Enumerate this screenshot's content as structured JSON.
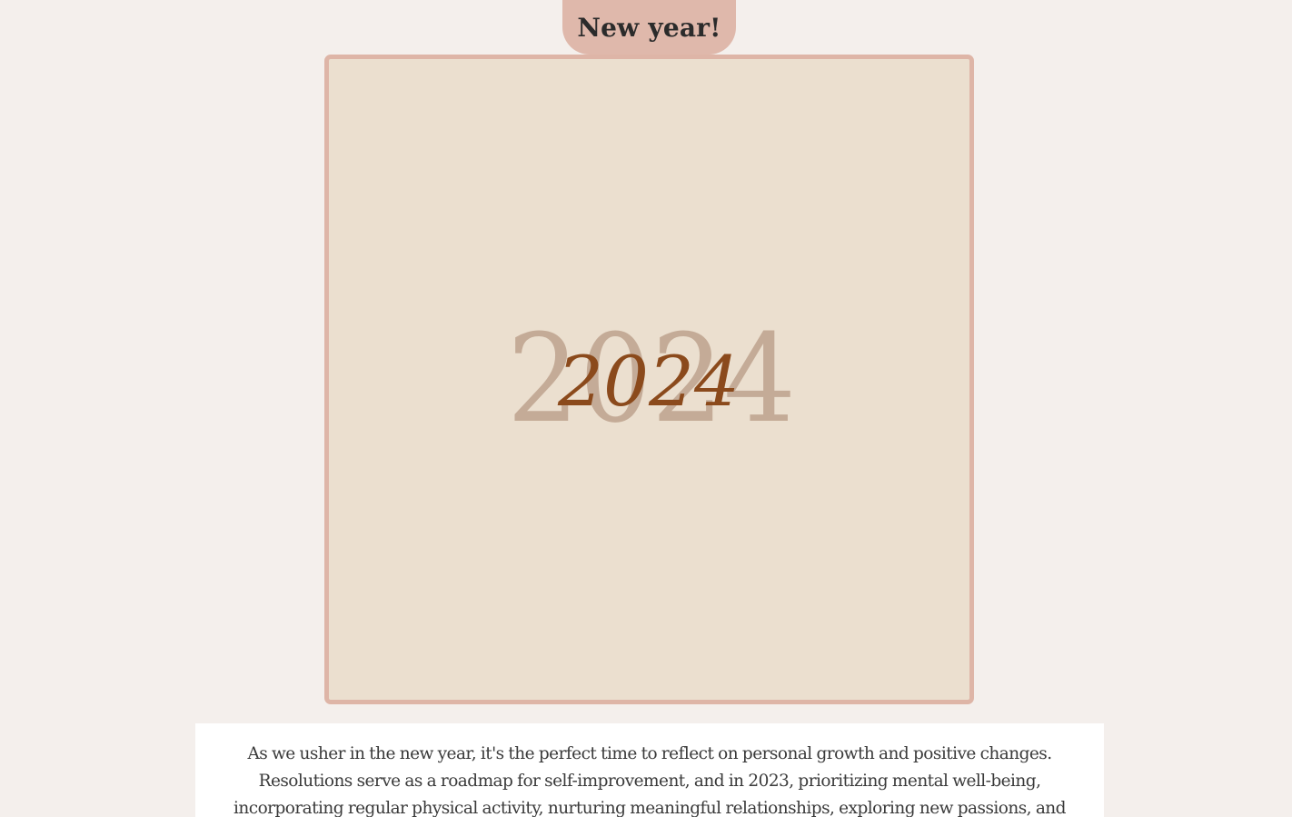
{
  "header": {
    "title": "New year!"
  },
  "hero_image": {
    "background_text": "2024",
    "script_text": "2024",
    "colors": {
      "frame_border": "#deb5a7",
      "frame_fill": "#ebdfcf",
      "background_numerals": "#c4ab97",
      "script_numerals": "#8b4a1c"
    }
  },
  "article": {
    "body": "As we usher in the new year, it's the perfect time to reflect on personal growth and positive changes. Resolutions serve as a roadmap for self-improvement, and in 2023, prioritizing mental well-being, incorporating regular physical activity, nurturing meaningful relationships, exploring new passions, and"
  },
  "theme": {
    "page_background": "#f4efec",
    "pill_background": "#dfb8ab",
    "card_background": "#ffffff",
    "text_color": "#3a3a3a"
  }
}
